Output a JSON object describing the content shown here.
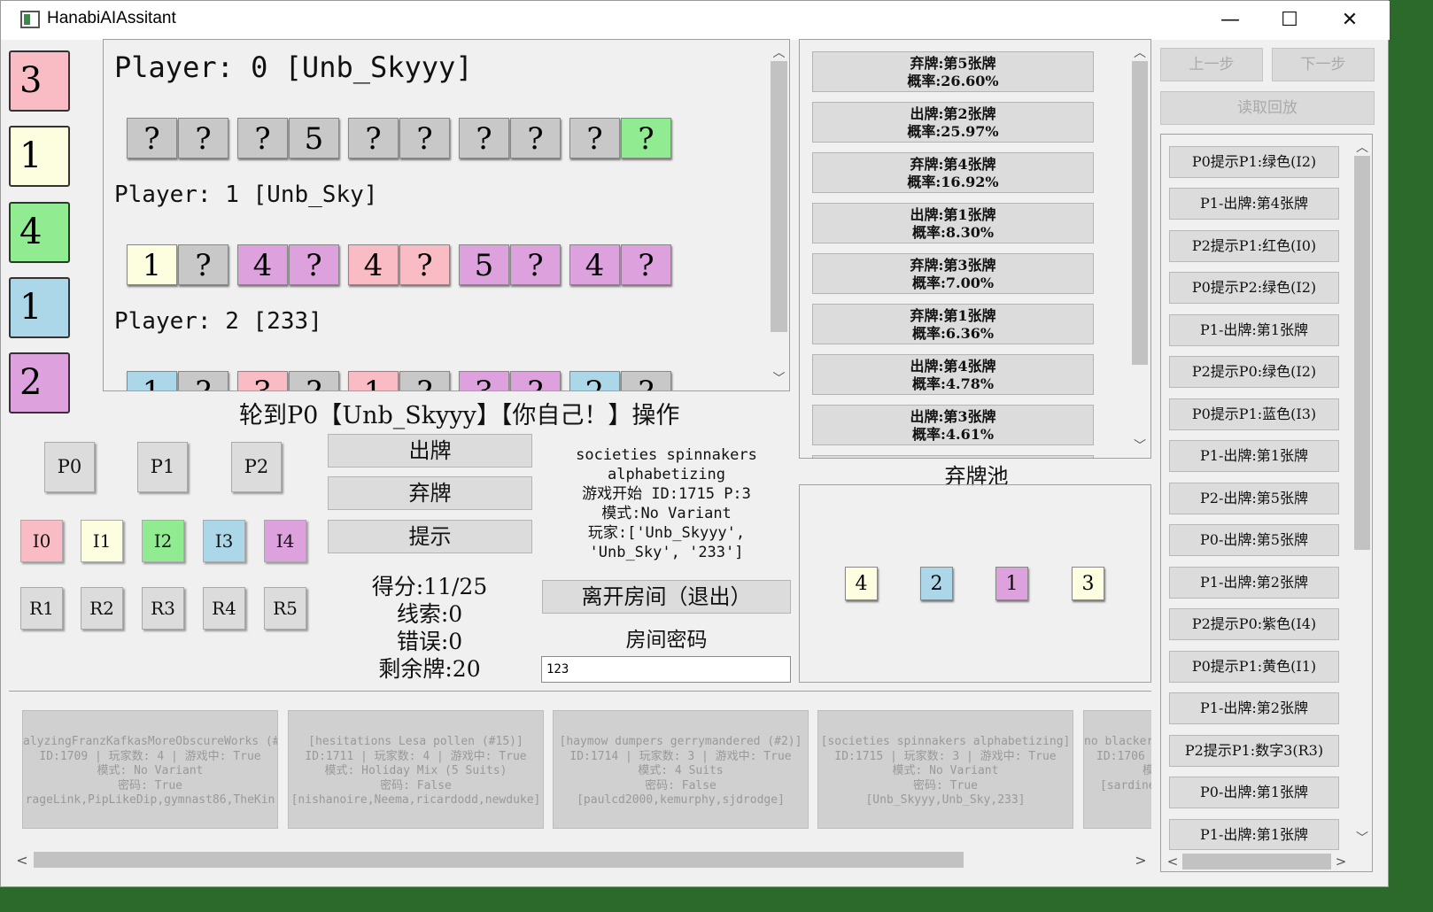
{
  "window": {
    "title": "HanabiAIAssitant",
    "minimize": "—",
    "maximize": "☐",
    "close": "✕"
  },
  "colors": {
    "red": "#f9bcc4",
    "yellow": "#fdfde0",
    "green": "#91ec91",
    "blue": "#acd7e8",
    "purple": "#dda2de",
    "gray": "#c8c8c8"
  },
  "fireworks": [
    "3",
    "1",
    "4",
    "1",
    "2"
  ],
  "players": [
    {
      "title": "Player: 0 [Unb_Skyyy]",
      "cards": [
        [
          "?",
          "?"
        ],
        [
          "?",
          "5"
        ],
        [
          "?",
          "?"
        ],
        [
          "?",
          "?"
        ],
        [
          "?",
          "?"
        ]
      ]
    },
    {
      "title": "Player: 1 [Unb_Sky]",
      "cards": [
        [
          "1",
          "?"
        ],
        [
          "4",
          "?"
        ],
        [
          "4",
          "?"
        ],
        [
          "5",
          "?"
        ],
        [
          "4",
          "?"
        ]
      ]
    },
    {
      "title": "Player: 2 [233]",
      "cards": [
        [
          "1",
          "?"
        ],
        [
          "3",
          "?"
        ],
        [
          "1",
          "?"
        ],
        [
          "3",
          "?"
        ],
        [
          "2",
          "?"
        ]
      ]
    }
  ],
  "turn": "轮到P0【Unb_Skyyy】【你自己！】操作",
  "target_players": [
    "P0",
    "P1",
    "P2"
  ],
  "color_buttons": [
    "I0",
    "I1",
    "I2",
    "I3",
    "I4"
  ],
  "rank_buttons": [
    "R1",
    "R2",
    "R3",
    "R4",
    "R5"
  ],
  "actions": {
    "play": "出牌",
    "discard": "弃牌",
    "hint": "提示"
  },
  "stats": {
    "score": "得分:11/25",
    "clues": "线索:0",
    "mistakes": "错误:0",
    "deck": "剩余牌:20"
  },
  "room_info": [
    "societies spinnakers",
    "alphabetizing",
    "游戏开始 ID:1715 P:3",
    "模式:No Variant",
    "玩家:['Unb_Skyyy',",
    "'Unb_Sky', '233']"
  ],
  "leave_button": "离开房间（退出）",
  "password_label": "房间密码",
  "password_value": "123",
  "probabilities": [
    {
      "action": "弃牌:第5张牌",
      "prob": "概率:26.60%"
    },
    {
      "action": "出牌:第2张牌",
      "prob": "概率:25.97%"
    },
    {
      "action": "弃牌:第4张牌",
      "prob": "概率:16.92%"
    },
    {
      "action": "出牌:第1张牌",
      "prob": "概率:8.30%"
    },
    {
      "action": "弃牌:第3张牌",
      "prob": "概率:7.00%"
    },
    {
      "action": "弃牌:第1张牌",
      "prob": "概率:6.36%"
    },
    {
      "action": "出牌:第4张牌",
      "prob": "概率:4.78%"
    },
    {
      "action": "出牌:第3张牌",
      "prob": "概率:4.61%"
    }
  ],
  "discard_pile_title": "弃牌池",
  "discard_pile": [
    "4",
    "2",
    "1",
    "3"
  ],
  "rooms": [
    [
      "alyzingFranzKafkasMoreObscureWorks (#",
      "ID:1709 | 玩家数: 4 | 游戏中: True",
      "模式: No Variant",
      "密码: True",
      "rageLink,PipLikeDip,gymnast86,TheKin"
    ],
    [
      "[hesitations Lesa pollen (#15)]",
      "ID:1711 | 玩家数: 4 | 游戏中: True",
      "模式: Holiday Mix (5 Suits)",
      "密码: False",
      "[nishanoire,Neema,ricardodd,newduke]"
    ],
    [
      "[haymow dumpers gerrymandered (#2)]",
      "ID:1714 | 玩家数: 3 | 游戏中: True",
      "模式: 4 Suits",
      "密码: False",
      "[paulcd2000,kemurphy,sjdrodge]"
    ],
    [
      "[societies spinnakers alphabetizing]",
      "ID:1715 | 玩家数: 3 | 游戏中: True",
      "模式: No Variant",
      "密码: True",
      "[Unb_Skyyy,Unb_Sky,233]"
    ],
    [
      "no blacker",
      "ID:1706",
      "模",
      "",
      "[sardine"
    ]
  ],
  "nav": {
    "prev": "上一步",
    "next": "下一步",
    "load": "读取回放"
  },
  "history": [
    "P0提示P1:绿色(I2)",
    "P1-出牌:第4张牌",
    "P2提示P1:红色(I0)",
    "P0提示P2:绿色(I2)",
    "P1-出牌:第1张牌",
    "P2提示P0:绿色(I2)",
    "P0提示P1:蓝色(I3)",
    "P1-出牌:第1张牌",
    "P2-出牌:第5张牌",
    "P0-出牌:第5张牌",
    "P1-出牌:第2张牌",
    "P2提示P0:紫色(I4)",
    "P0提示P1:黄色(I1)",
    "P1-出牌:第2张牌",
    "P2提示P1:数字3(R3)",
    "P0-出牌:第1张牌",
    "P1-出牌:第1张牌"
  ]
}
